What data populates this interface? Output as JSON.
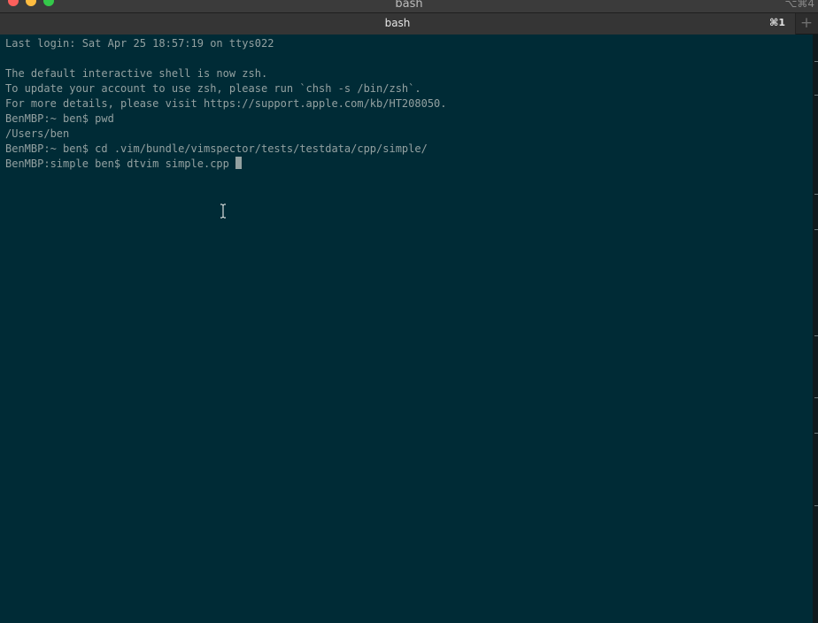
{
  "window": {
    "title": "bash",
    "shortcut_hint": "⌥⌘4"
  },
  "tabs": [
    {
      "label": "bash",
      "shortcut": "⌘1"
    }
  ],
  "new_tab_label": "+",
  "terminal": {
    "lines": [
      "Last login: Sat Apr 25 18:57:19 on ttys022",
      "",
      "The default interactive shell is now zsh.",
      "To update your account to use zsh, please run `chsh -s /bin/zsh`.",
      "For more details, please visit https://support.apple.com/kb/HT208050.",
      "BenMBP:~ ben$ pwd",
      "/Users/ben",
      "BenMBP:~ ben$ cd .vim/bundle/vimspector/tests/testdata/cpp/simple/",
      "BenMBP:simple ben$ dtvim simple.cpp "
    ]
  },
  "colors": {
    "terminal_bg": "#002b36",
    "terminal_fg": "#93a1a1",
    "close": "#fc605c",
    "minimize": "#fdbc40",
    "zoom": "#34c84a"
  }
}
